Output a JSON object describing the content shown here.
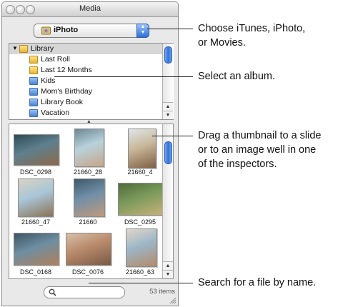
{
  "window": {
    "title": "Media"
  },
  "source_popup": {
    "selected": "iPhoto",
    "icon": "iphoto-icon"
  },
  "albums": [
    {
      "label": "Library",
      "icon": "library-icon",
      "disclosure": "▼"
    },
    {
      "label": "Last Roll",
      "icon": "last-roll-icon"
    },
    {
      "label": "Last 12 Months",
      "icon": "calendar-folder-icon"
    },
    {
      "label": "Kids",
      "icon": "album-icon"
    },
    {
      "label": "Mom's Birthday",
      "icon": "album-icon"
    },
    {
      "label": "Library Book",
      "icon": "album-icon"
    },
    {
      "label": "Vacation",
      "icon": "album-icon"
    }
  ],
  "photos": [
    {
      "name": "DSC_0298",
      "colors": [
        "#5e7f8e",
        "#8b6a4a",
        "#2f4a55"
      ]
    },
    {
      "name": "21660_28",
      "colors": [
        "#b9d2dc",
        "#c7a58a",
        "#6d8894"
      ]
    },
    {
      "name": "21660_4",
      "colors": [
        "#c9b89a",
        "#7e5f44",
        "#dfe6ea"
      ]
    },
    {
      "name": "21660_47",
      "colors": [
        "#a9c6d8",
        "#8b7355",
        "#d9d2c2"
      ]
    },
    {
      "name": "21660",
      "colors": [
        "#6f8fa8",
        "#c29a7b",
        "#3f5868"
      ]
    },
    {
      "name": "DSC_0295",
      "colors": [
        "#7a9a5a",
        "#c9b07a",
        "#4f6b3a"
      ]
    },
    {
      "name": "DSC_0168",
      "colors": [
        "#6e8ea2",
        "#b0805a",
        "#3e5462"
      ]
    },
    {
      "name": "DSC_0076",
      "colors": [
        "#b98a6b",
        "#7a5a44",
        "#d6c0a8"
      ]
    },
    {
      "name": "21660_63",
      "colors": [
        "#9cb6c8",
        "#b48a68",
        "#e2d7c8"
      ]
    }
  ],
  "search": {
    "placeholder": "",
    "icon": "magnifier-icon",
    "count_label": "53 items"
  },
  "callouts": [
    {
      "text": "Choose iTunes, iPhoto,\nor Movies."
    },
    {
      "text": "Select an album."
    },
    {
      "text": "Drag a thumbnail to a slide\nor to an image well in one\nof the inspectors."
    },
    {
      "text": "Search for a file by name."
    }
  ]
}
